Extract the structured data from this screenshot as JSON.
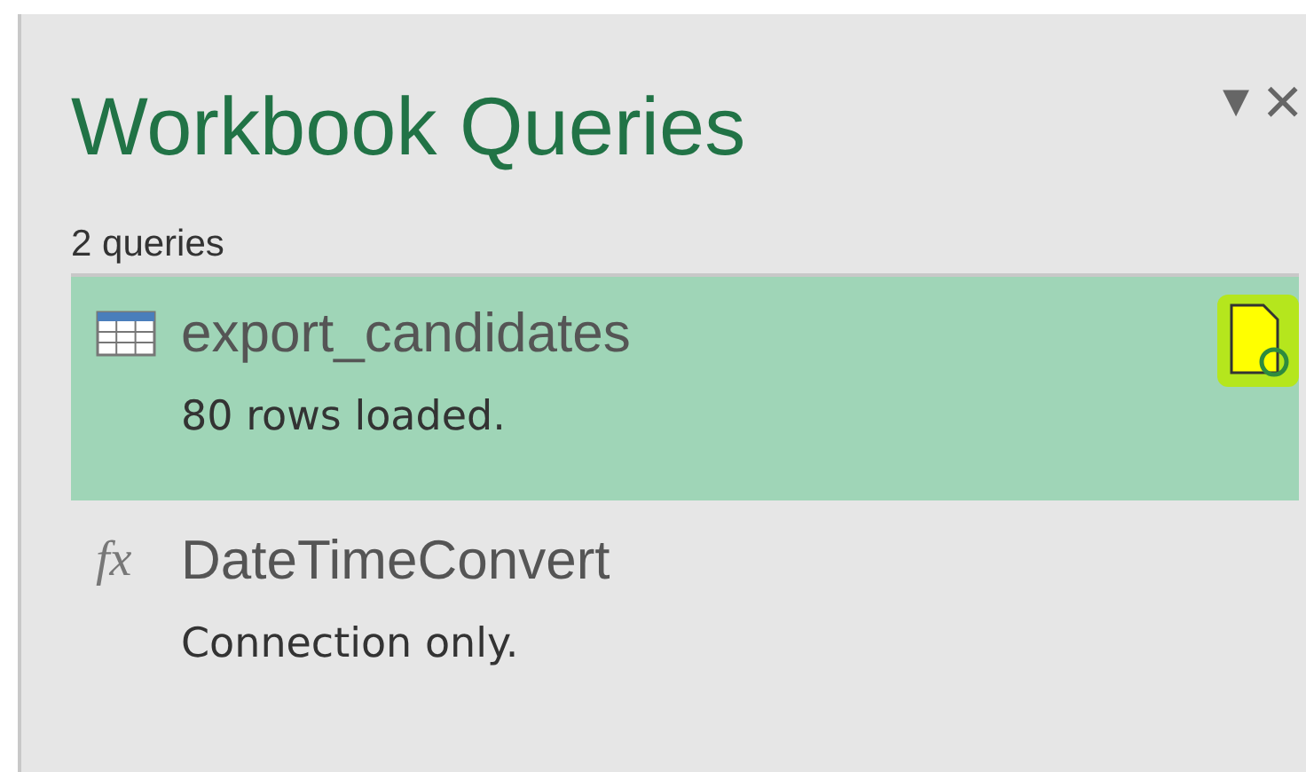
{
  "pane": {
    "title": "Workbook Queries",
    "menu_symbol": "▾",
    "close_symbol": "×"
  },
  "count": "2 queries",
  "queries": [
    {
      "kind": "table",
      "name": "export_candidates",
      "status": "80 rows loaded.",
      "selected": true,
      "refresh_badge": true
    },
    {
      "kind": "function",
      "symbol": "fx",
      "name": "DateTimeConvert",
      "status": "Connection only.",
      "selected": false,
      "refresh_badge": false
    }
  ]
}
